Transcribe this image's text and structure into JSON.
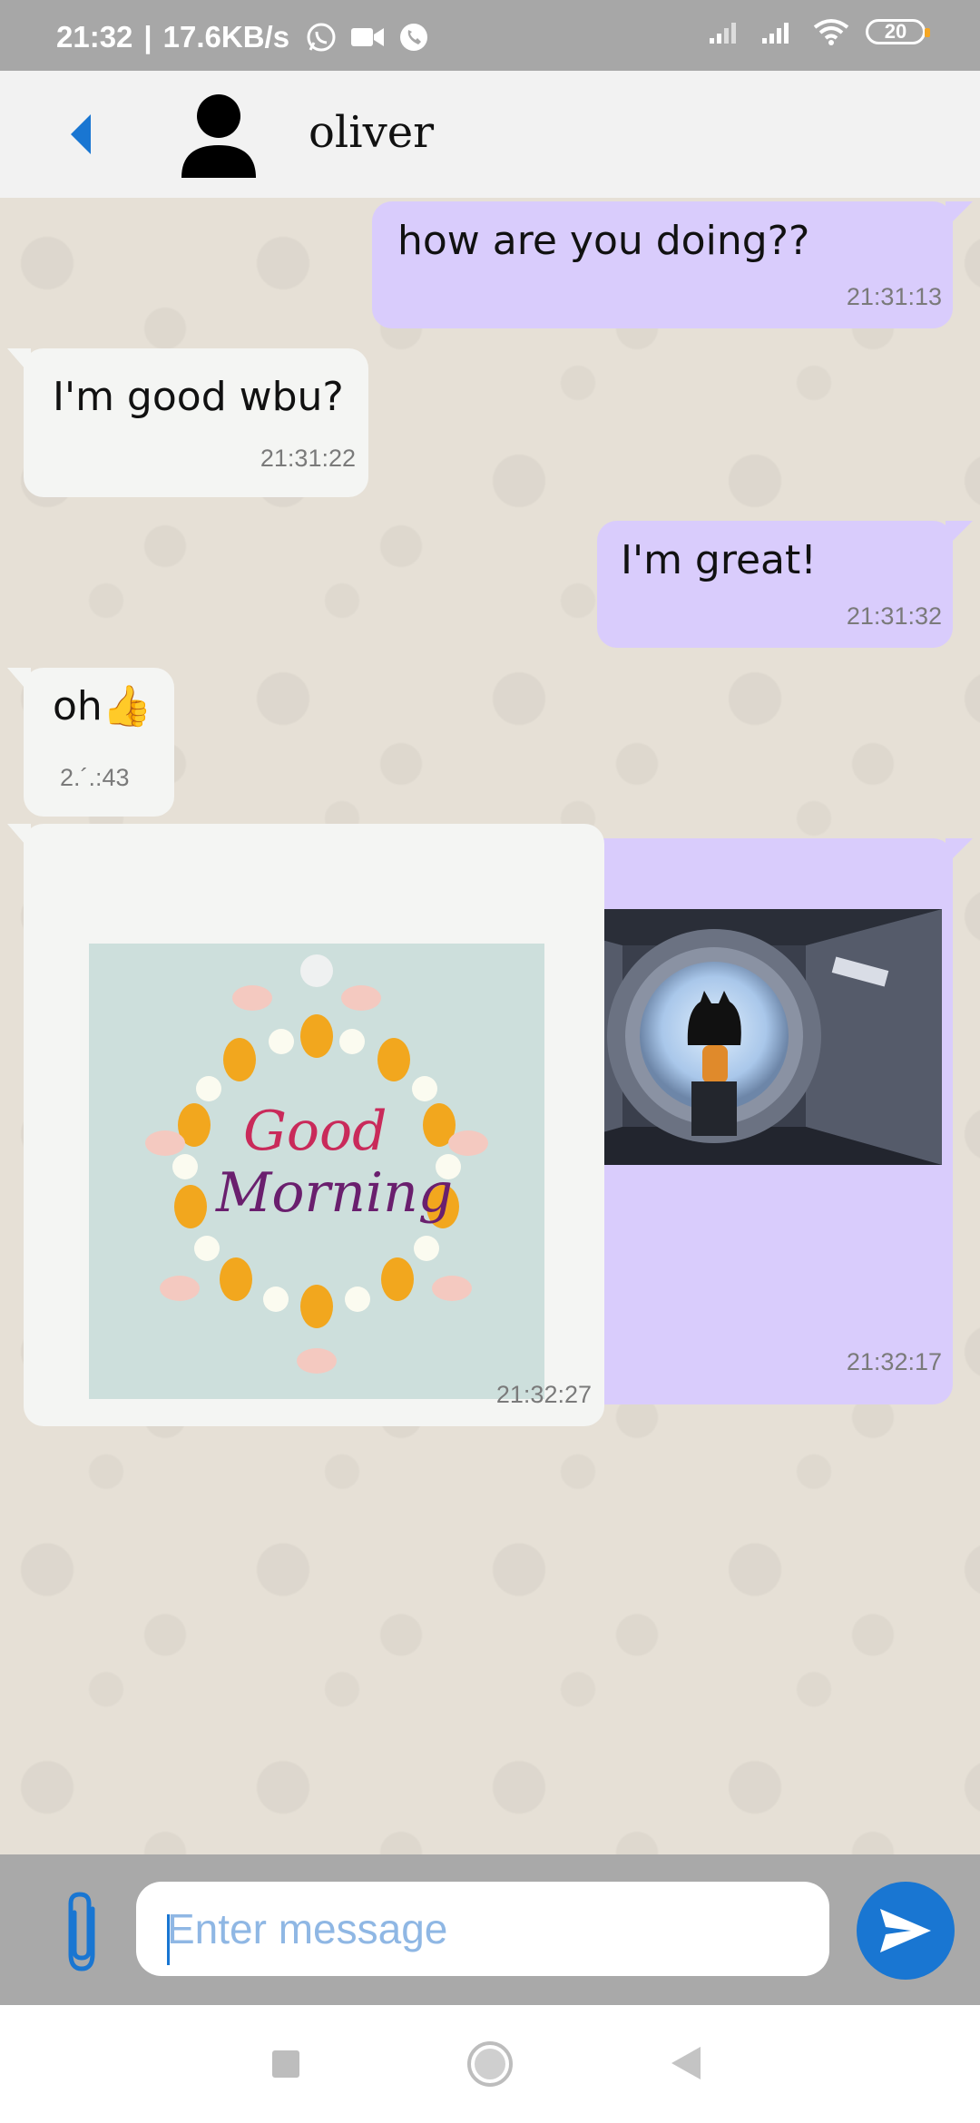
{
  "status_bar": {
    "time": "21:32",
    "speed": "17.6KB/s",
    "battery": "20",
    "icons": [
      "whatsapp-icon",
      "video-call-icon",
      "phone-icon",
      "signal-icon",
      "signal-icon",
      "wifi-icon",
      "battery-icon"
    ]
  },
  "header": {
    "contact_name": "oliver",
    "back_icon": "chevron-left-icon",
    "avatar_icon": "person-icon"
  },
  "messages": [
    {
      "direction": "sent",
      "text": "how are you doing??",
      "time": "21:31:13"
    },
    {
      "direction": "received",
      "text": "I'm good wbu?",
      "time": "21:31:22"
    },
    {
      "direction": "sent",
      "text": "I'm great!",
      "time": "21:31:32"
    },
    {
      "direction": "received",
      "text": "oh👍",
      "time": "2.´.:43"
    },
    {
      "direction": "sent",
      "image": "octocat-spaceship-image",
      "time": "21:32:17"
    },
    {
      "direction": "received",
      "image": "good-morning-flowers-image",
      "image_text": [
        "Good",
        "Morning"
      ],
      "time": "21:32:27"
    }
  ],
  "composer": {
    "placeholder": "Enter message",
    "value": "",
    "attach_icon": "paperclip-icon",
    "send_icon": "send-icon"
  },
  "colors": {
    "sent_bubble": "#d9ccfc",
    "received_bubble": "#f4f5f3",
    "accent": "#1976d2",
    "status_bar": "#a7a7a7",
    "input_bar": "#a9a9a9"
  },
  "nav_bar": {
    "icons": [
      "recents-square-icon",
      "home-circle-icon",
      "back-triangle-icon"
    ]
  }
}
